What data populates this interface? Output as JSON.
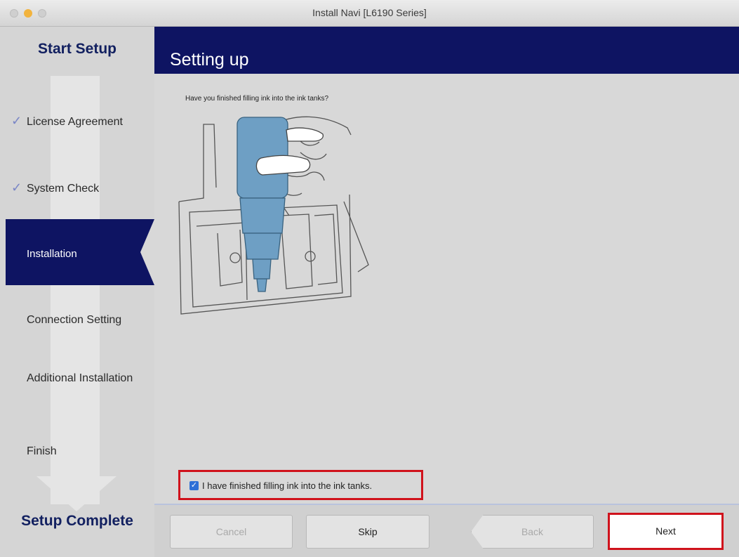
{
  "window": {
    "title": "Install Navi [L6190 Series]",
    "accent_color": "#0e1462",
    "highlight_color": "#d0121c"
  },
  "sidebar": {
    "start_label": "Start Setup",
    "complete_label": "Setup Complete",
    "steps": [
      {
        "label": "License Agreement",
        "done": true
      },
      {
        "label": "System Check",
        "done": true
      },
      {
        "label": "Installation",
        "active": true
      },
      {
        "label": "Connection Setting"
      },
      {
        "label": "Additional Installation"
      },
      {
        "label": "Finish"
      }
    ],
    "check_mark": "✓"
  },
  "main": {
    "header_title": "Setting up",
    "question": "Have you finished filling ink into the ink tanks?",
    "illustration_icon": "ink-bottle-filling-illustration",
    "confirm": {
      "checked": true,
      "label": "I have finished filling ink into the ink tanks."
    }
  },
  "footer": {
    "cancel_label": "Cancel",
    "skip_label": "Skip",
    "back_label": "Back",
    "next_label": "Next"
  }
}
